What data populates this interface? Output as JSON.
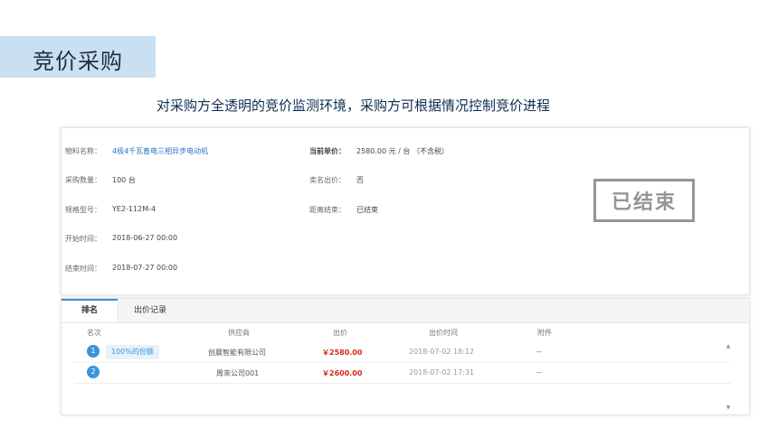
{
  "header": {
    "title": "竞价采购",
    "subtitle": "对采购方全透明的竞价监测环境，采购方可根据情况控制竞价进程"
  },
  "detail": {
    "material_label": "物料名称：",
    "material_value": "4极4千瓦畜电三相异步电动机",
    "quantity_label": "采购数量：",
    "quantity_value": "100 台",
    "model_label": "规格型号：",
    "model_value": "YE2-112M-4",
    "start_label": "开始时间：",
    "start_value": "2018-06-27 00:00",
    "end_label": "结束时间：",
    "end_value": "2018-07-27 00:00",
    "unit_price_label": "当前单价：",
    "unit_price_value": "2580.00 元 / 台 （不含税）",
    "seller_label": "卖名出价：",
    "seller_value": "否",
    "remaining_label": "距离结束：",
    "remaining_value": "已结束",
    "stamp_text": "已结束"
  },
  "tabs": [
    {
      "label": "排名",
      "active": true
    },
    {
      "label": "出价记录",
      "active": false
    }
  ],
  "table": {
    "columns": [
      "名次",
      "供应商",
      "出价",
      "出价时间",
      "附件"
    ],
    "rows": [
      {
        "rank": "1",
        "tag": "100%的份额",
        "supplier": "创晨智能有限公司",
        "price": "￥2580.00",
        "time": "2018-07-02 18:12",
        "attachment": "--"
      },
      {
        "rank": "2",
        "tag": "",
        "supplier": "周來公司001",
        "price": "￥2600.00",
        "time": "2018-07-02 17:31",
        "attachment": "--"
      }
    ]
  },
  "colors": {
    "accent": "#3a95d8",
    "price_red": "#d9261c",
    "title_bg": "#c9dff2"
  }
}
